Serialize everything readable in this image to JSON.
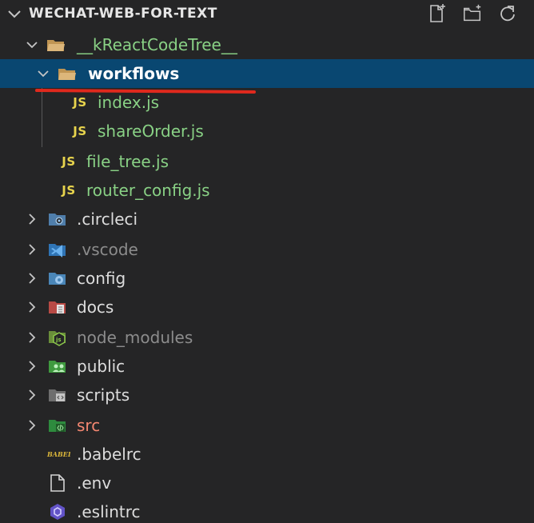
{
  "header": {
    "title": "WECHAT-WEB-FOR-TEXT",
    "actions": [
      "new-file-icon",
      "new-folder-icon",
      "refresh-icon"
    ]
  },
  "tree": {
    "root_folder": "__kReactCodeTree__",
    "selected_folder": "workflows",
    "workflow_files": [
      "index.js",
      "shareOrder.js"
    ],
    "root_files": [
      "file_tree.js",
      "router_config.js"
    ],
    "folders": [
      ".circleci",
      ".vscode",
      "config",
      "docs",
      "node_modules",
      "public",
      "scripts",
      "src"
    ],
    "files": [
      ".babelrc",
      ".env",
      ".eslintrc"
    ],
    "js_badge": "JS",
    "babel_badge": "BABEL"
  },
  "colors": {
    "background": "#252526",
    "selection": "#094771",
    "modified_green": "#89d185",
    "ignored_gray": "#8c8c8c",
    "error_red": "#f48771",
    "js_yellow": "#e8d44d",
    "annotation_red": "#e0291d"
  }
}
